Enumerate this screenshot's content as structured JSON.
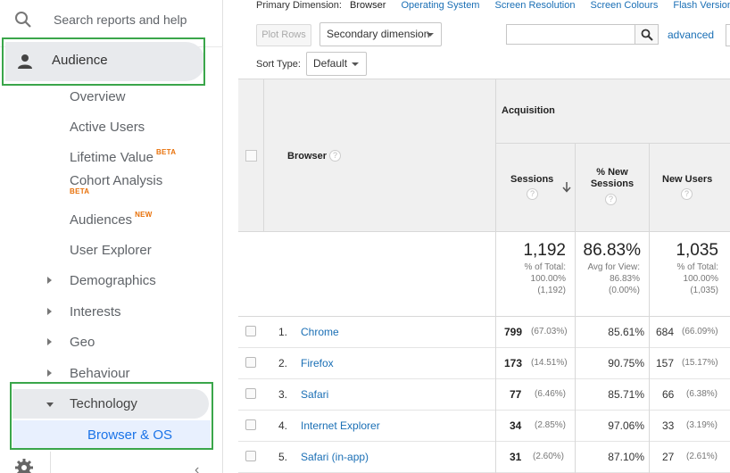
{
  "sidebar": {
    "search_placeholder": "Search reports and help",
    "audience_label": "Audience",
    "items": [
      {
        "label": "Overview"
      },
      {
        "label": "Active Users"
      },
      {
        "label": "Lifetime Value",
        "badge": "BETA"
      },
      {
        "label": "Cohort Analysis",
        "badge": "BETA"
      },
      {
        "label": "Audiences",
        "badge": "NEW"
      },
      {
        "label": "User Explorer"
      },
      {
        "label": "Demographics"
      },
      {
        "label": "Interests"
      },
      {
        "label": "Geo"
      },
      {
        "label": "Behaviour"
      },
      {
        "label": "Technology"
      },
      {
        "label": "Browser & OS"
      }
    ],
    "collapse_glyph": "‹"
  },
  "toolbar": {
    "primary_dimension_label": "Primary Dimension:",
    "dimensions": [
      "Browser",
      "Operating System",
      "Screen Resolution",
      "Screen Colours",
      "Flash Version"
    ],
    "active_dimension": "Browser",
    "plot_rows": "Plot Rows",
    "secondary_dimension": "Secondary dimension",
    "advanced": "advanced",
    "sort_type_label": "Sort Type:",
    "sort_type_value": "Default"
  },
  "table": {
    "dimension_header": "Browser",
    "group_header": "Acquisition",
    "columns": [
      "Sessions",
      "% New Sessions",
      "New Users"
    ],
    "totals": {
      "sessions": "1,192",
      "sessions_sub1": "% of Total:",
      "sessions_sub2": "100.00%",
      "sessions_sub3": "(1,192)",
      "new_sessions": "86.83%",
      "new_sessions_sub1": "Avg for View:",
      "new_sessions_sub2": "86.83%",
      "new_sessions_sub3": "(0.00%)",
      "new_users": "1,035",
      "new_users_sub1": "% of Total:",
      "new_users_sub2": "100.00%",
      "new_users_sub3": "(1,035)"
    },
    "rows": [
      {
        "num": "1.",
        "name": "Chrome",
        "sessions": "799",
        "sessions_pct": "(67.03%)",
        "new_pct": "85.61%",
        "new_users": "684",
        "new_users_pct": "(66.09%)"
      },
      {
        "num": "2.",
        "name": "Firefox",
        "sessions": "173",
        "sessions_pct": "(14.51%)",
        "new_pct": "90.75%",
        "new_users": "157",
        "new_users_pct": "(15.17%)"
      },
      {
        "num": "3.",
        "name": "Safari",
        "sessions": "77",
        "sessions_pct": "(6.46%)",
        "new_pct": "85.71%",
        "new_users": "66",
        "new_users_pct": "(6.38%)"
      },
      {
        "num": "4.",
        "name": "Internet Explorer",
        "sessions": "34",
        "sessions_pct": "(2.85%)",
        "new_pct": "97.06%",
        "new_users": "33",
        "new_users_pct": "(3.19%)"
      },
      {
        "num": "5.",
        "name": "Safari (in-app)",
        "sessions": "31",
        "sessions_pct": "(2.60%)",
        "new_pct": "87.10%",
        "new_users": "27",
        "new_users_pct": "(2.61%)"
      }
    ]
  },
  "colors": {
    "link": "#1a6fb5",
    "highlight_box": "#3aa64a",
    "badge": "#e8710a",
    "selected_nav": "#1a73e8"
  }
}
